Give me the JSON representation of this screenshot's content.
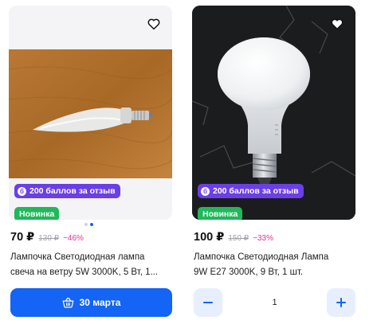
{
  "products": [
    {
      "points_badge": "200 баллов за отзыв",
      "points_icon": "б",
      "new_badge": "Новинка",
      "price": "70 ₽",
      "old_price": "130 ₽",
      "discount": "−46%",
      "title_line1": "Лампочка Светодиодная лампа",
      "title_line2": "свеча на ветру 5W 3000K, 5 Вт, 1...",
      "cart_button_label": "30 марта",
      "favorite_icon": "heart-outline-icon",
      "image_dots_count": 2,
      "image_dots_active_index": 1
    },
    {
      "points_badge": "200 баллов за отзыв",
      "points_icon": "б",
      "new_badge": "Новинка",
      "price": "100 ₽",
      "old_price": "150 ₽",
      "discount": "−33%",
      "title_line1": "Лампочка Светодиодная Лампа",
      "title_line2": "9W E27 3000K, 9 Вт, 1 шт.",
      "quantity": "1",
      "favorite_icon": "heart-outline-icon"
    }
  ],
  "colors": {
    "accent_blue": "#1464f5",
    "points_purple": "#6b3fe6",
    "new_green": "#1fb85a",
    "discount_pink": "#ec2f8a"
  }
}
